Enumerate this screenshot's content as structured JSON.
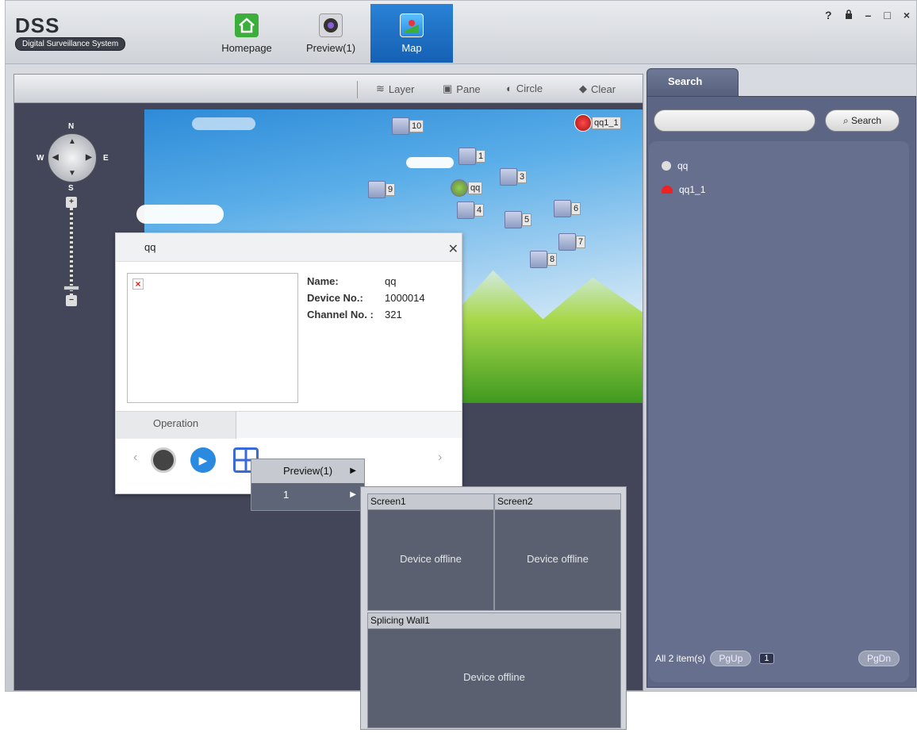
{
  "app": {
    "logo": "DSS",
    "subtitle": "Digital Surveillance System"
  },
  "nav": {
    "tabs": [
      {
        "label": "Homepage"
      },
      {
        "label": "Preview(1)"
      },
      {
        "label": "Map"
      }
    ],
    "active": "Map"
  },
  "window_controls": {
    "help": "?",
    "lock": "lock-icon",
    "minimize": "–",
    "maximize": "□",
    "close": "×"
  },
  "toolbar": {
    "layer": "Layer",
    "pane": "Pane",
    "circle": "Circle",
    "clear": "Clear"
  },
  "compass": {
    "n": "N",
    "s": "S",
    "w": "W",
    "e": "E",
    "zoom_in": "+",
    "zoom_out": "−"
  },
  "markers": [
    {
      "label": "10"
    },
    {
      "label": "1"
    },
    {
      "label": "3"
    },
    {
      "label": "9"
    },
    {
      "label": "qq"
    },
    {
      "label": "4"
    },
    {
      "label": "5"
    },
    {
      "label": "6"
    },
    {
      "label": "7"
    },
    {
      "label": "8"
    },
    {
      "label": "qq1_1"
    }
  ],
  "popup": {
    "title": "qq",
    "info": {
      "name_key": "Name:",
      "name_val": "qq",
      "device_key": "Device No.:",
      "device_val": "1000014",
      "channel_key": "Channel No. :",
      "channel_val": "321"
    },
    "operation_tab": "Operation"
  },
  "menu1": {
    "item1": "Preview(1)",
    "item2": "1"
  },
  "screens": {
    "screen1": {
      "title": "Screen1",
      "status": "Device offline"
    },
    "screen2": {
      "title": "Screen2",
      "status": "Device offline"
    },
    "wall": {
      "title": "Splicing Wall1",
      "status": "Device offline"
    }
  },
  "search": {
    "tab": "Search",
    "button": "Search",
    "input_value": "",
    "results": [
      {
        "name": "qq"
      },
      {
        "name": "qq1_1"
      }
    ],
    "pager": {
      "total": "All 2 item(s)",
      "pgup": "PgUp",
      "page": "1",
      "pgdn": "PgDn"
    }
  }
}
